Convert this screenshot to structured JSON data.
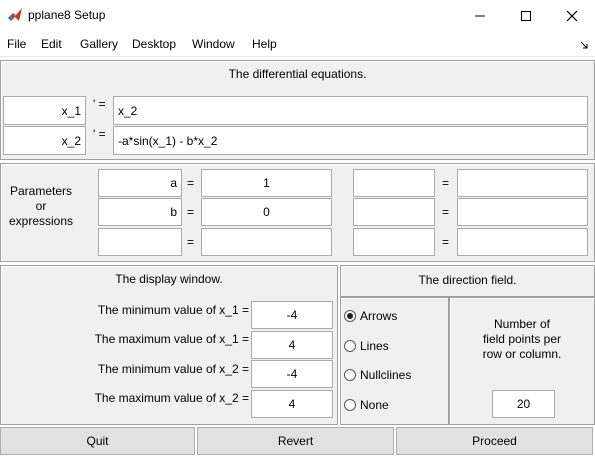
{
  "window": {
    "title": "pplane8 Setup"
  },
  "menu": [
    "File",
    "Edit",
    "Gallery",
    "Desktop",
    "Window",
    "Help"
  ],
  "equations": {
    "heading": "The differential equations.",
    "prime_mark": "' =",
    "rows": [
      {
        "var": "x_1",
        "rhs": "x_2"
      },
      {
        "var": "x_2",
        "rhs": "-a*sin(x_1) - b*x_2"
      }
    ]
  },
  "parameters": {
    "label_line1": "Parameters",
    "label_line2": "or",
    "label_line3": "expressions",
    "eq": "=",
    "left": [
      {
        "name": "a",
        "value": "1"
      },
      {
        "name": "b",
        "value": "0"
      },
      {
        "name": "",
        "value": ""
      }
    ],
    "right": [
      {
        "name": "",
        "value": ""
      },
      {
        "name": "",
        "value": ""
      },
      {
        "name": "",
        "value": ""
      }
    ]
  },
  "display_window": {
    "heading": "The display window.",
    "rows": [
      {
        "label": "The minimum value of x_1 =",
        "value": "-4"
      },
      {
        "label": "The maximum value of x_1 =",
        "value": "4"
      },
      {
        "label": "The minimum value of x_2 =",
        "value": "-4"
      },
      {
        "label": "The maximum value of x_2 =",
        "value": "4"
      }
    ]
  },
  "direction_field": {
    "heading": "The direction field.",
    "options": [
      "Arrows",
      "Lines",
      "Nullclines",
      "None"
    ],
    "selected": "Arrows",
    "points_label_1": "Number of",
    "points_label_2": "field points per",
    "points_label_3": "row or column.",
    "points_value": "20"
  },
  "buttons": {
    "quit": "Quit",
    "revert": "Revert",
    "proceed": "Proceed"
  }
}
